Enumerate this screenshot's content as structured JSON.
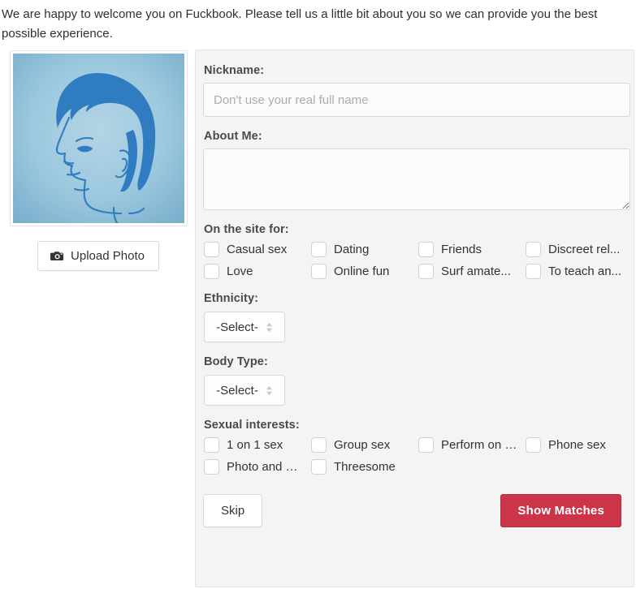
{
  "intro": {
    "text": "We are happy to welcome you on Fuckbook. Please tell us a little bit about you so we can provide you the best possible experience."
  },
  "photo": {
    "avatar_alt": "default-male-profile-avatar",
    "avatar_bg_outer": "#7cb0cd",
    "avatar_bg_inner": "#a9cde0",
    "avatar_ink": "#2f7cc0",
    "upload_label": "Upload Photo",
    "upload_icon": "camera-icon"
  },
  "form": {
    "nickname": {
      "label": "Nickname:",
      "placeholder": "Don't use your real full name",
      "value": ""
    },
    "about_me": {
      "label": "About Me:",
      "value": ""
    },
    "site_for": {
      "label": "On the site for:",
      "options": [
        "Casual sex",
        "Dating",
        "Friends",
        "Discreet rel...",
        "Love",
        "Online fun",
        "Surf amate...",
        "To teach an..."
      ]
    },
    "ethnicity": {
      "label": "Ethnicity:",
      "selected": "-Select-"
    },
    "body_type": {
      "label": "Body Type:",
      "selected": "-Select-"
    },
    "sexual_interests": {
      "label": "Sexual interests:",
      "options": [
        "1 on 1 sex",
        "Group sex",
        "Perform on …",
        "Phone sex",
        "Photo and …",
        "Threesome"
      ]
    },
    "actions": {
      "skip_label": "Skip",
      "submit_label": "Show Matches",
      "submit_color": "#cb3449"
    }
  }
}
